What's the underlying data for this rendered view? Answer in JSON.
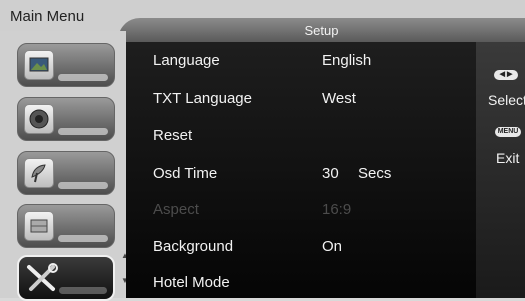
{
  "header": {
    "main_menu": "Main Menu",
    "page_title": "Setup"
  },
  "sidebar": {
    "items": [
      {
        "icon": "picture-icon"
      },
      {
        "icon": "speaker-icon"
      },
      {
        "icon": "satellite-dish-icon"
      },
      {
        "icon": "timer-icon"
      },
      {
        "icon": "tools-icon",
        "active": true
      }
    ]
  },
  "menu": {
    "items": [
      {
        "label": "Language",
        "value": "English"
      },
      {
        "label": "TXT Language",
        "value": "West"
      },
      {
        "label": "Reset",
        "value": ""
      },
      {
        "label": "Osd Time",
        "value": "30",
        "unit": "Secs"
      },
      {
        "label": "Aspect",
        "value": "16:9",
        "disabled": true
      },
      {
        "label": "Background",
        "value": "On"
      },
      {
        "label": "Hotel Mode",
        "value": ""
      }
    ]
  },
  "help": {
    "select_key": "◀ ▶",
    "select_label": "Select",
    "menu_key": "MENU",
    "exit_label": "Exit"
  },
  "colors": {
    "panel": "#0f0f0f",
    "text": "#f2f2f2",
    "disabled_text": "#4c4c4c"
  }
}
